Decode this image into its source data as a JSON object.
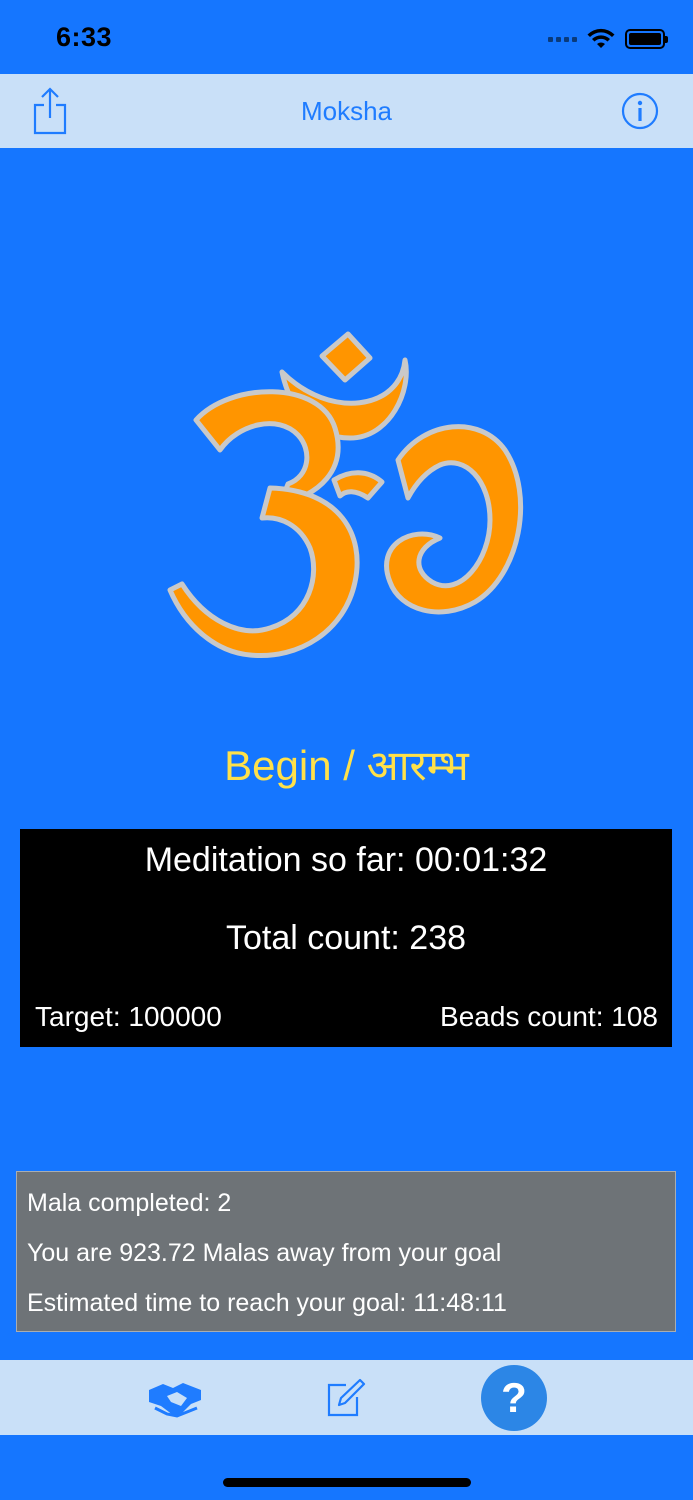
{
  "status_bar": {
    "time": "6:33"
  },
  "nav": {
    "title": "Moksha",
    "share_icon": "share-icon",
    "info_icon": "info-icon"
  },
  "main": {
    "om_icon": "om-symbol-icon",
    "begin_label": "Begin / आरम्भ",
    "stats": {
      "meditation": "Meditation so far: 00:01:32",
      "total": "Total count: 238",
      "target": "Target: 100000",
      "beads": "Beads count: 108"
    },
    "info": {
      "mala_completed": "Mala completed: 2",
      "malas_away": "You are 923.72 Malas away from your goal",
      "estimated_time": "Estimated time to reach your goal: 11:48:11"
    }
  },
  "toolbar": {
    "buttons": [
      "handshake-icon",
      "edit-icon",
      "help-icon"
    ],
    "help_glyph": "?"
  },
  "colors": {
    "background": "#1576ff",
    "bar": "#c9e0f8",
    "accent": "#1f7cff",
    "om": "#ff9500",
    "begin_text": "#ffe14a",
    "stats_bg": "#000000",
    "info_bg": "#6e7377"
  }
}
